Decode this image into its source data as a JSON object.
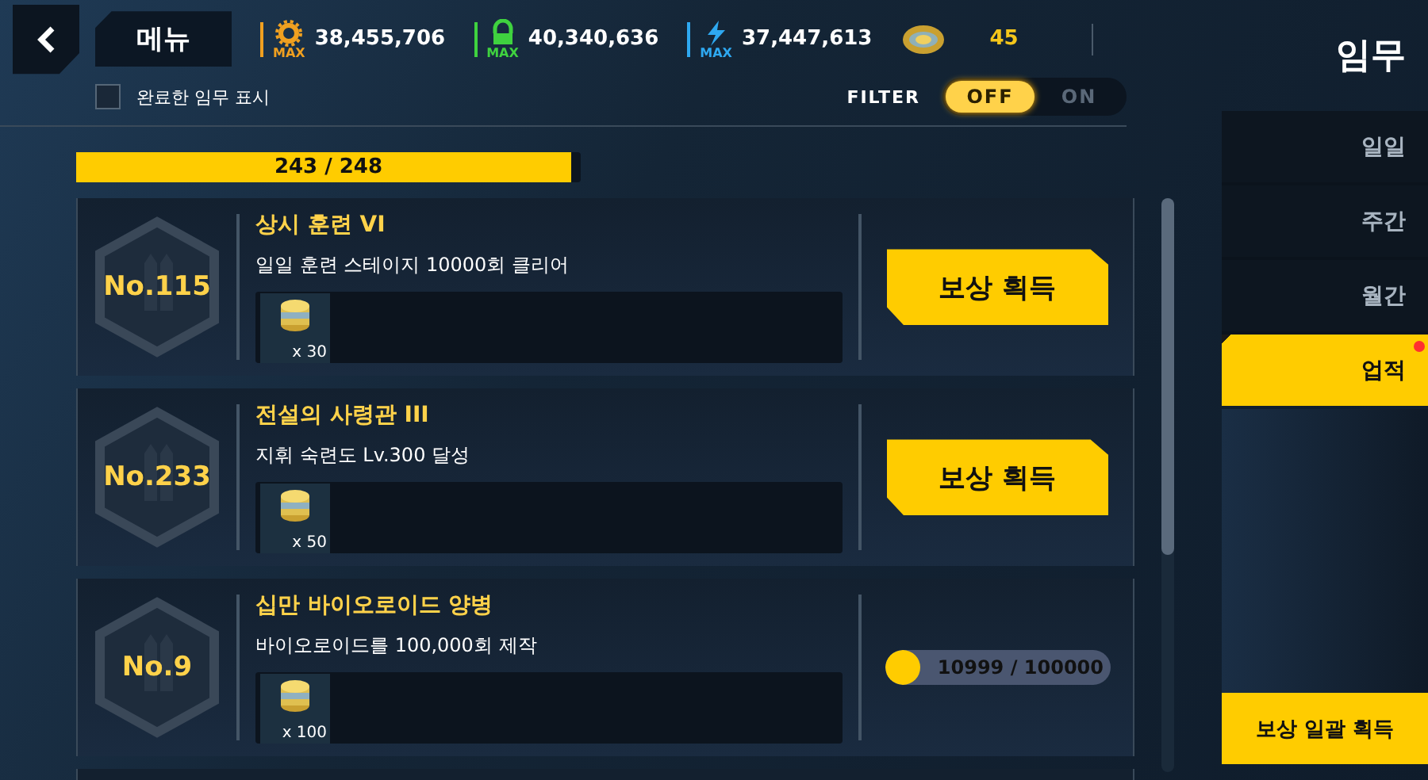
{
  "menu_label": "메뉴",
  "resources": [
    {
      "kind": "gear",
      "badge": "MAX",
      "value": "38,455,706"
    },
    {
      "kind": "lock",
      "badge": "MAX",
      "value": "40,340,636"
    },
    {
      "kind": "bolt",
      "badge": "MAX",
      "value": "37,447,613"
    },
    {
      "kind": "coin",
      "value": "45"
    }
  ],
  "page_title": "임무",
  "show_completed": {
    "label": "완료한 임무 표시",
    "checked": false
  },
  "filter": {
    "label": "FILTER",
    "options": [
      {
        "label": "OFF",
        "selected": true
      },
      {
        "label": "ON",
        "selected": false
      }
    ]
  },
  "progress": {
    "text": "243 / 248",
    "level": 0.98
  },
  "missions": [
    {
      "kind": "claim",
      "number": "No.115",
      "title": "상시 훈련 VI",
      "description": "일일 훈련 스테이지 10000회 클리어",
      "reward_count": "x 30",
      "action": "보상 획득"
    },
    {
      "kind": "claim",
      "number": "No.233",
      "title": "전설의 사령관 III",
      "description": "지휘 숙련도 Lv.300 달성",
      "reward_count": "x 50",
      "action": "보상 획득"
    },
    {
      "kind": "progress",
      "number": "No.9",
      "title": "십만 바이오로이드 양병",
      "description": "바이오로이드를 100,000회 제작",
      "reward_count": "x 100",
      "progress_text": "10999 / 100000",
      "level": 0.11
    }
  ],
  "tabs": [
    {
      "label": "일일",
      "selected": false,
      "notification": false
    },
    {
      "label": "주간",
      "selected": false,
      "notification": false
    },
    {
      "label": "월간",
      "selected": false,
      "notification": false
    },
    {
      "label": "업적",
      "selected": true,
      "notification": true
    }
  ],
  "claim_all_button": "보상 일괄 획득"
}
